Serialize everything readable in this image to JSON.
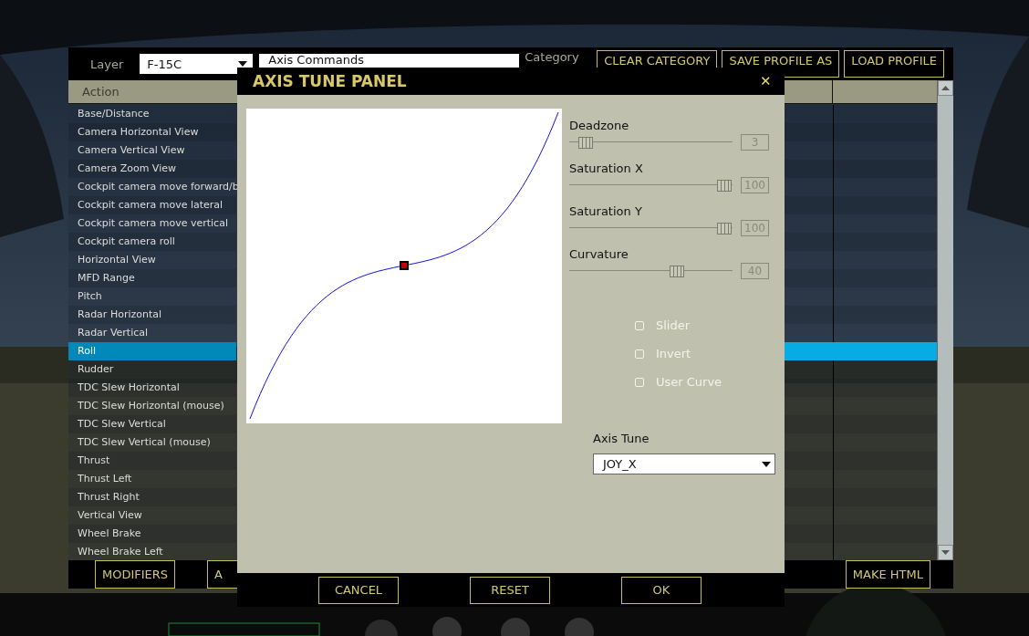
{
  "layer": {
    "label": "Layer",
    "value": "F-15C"
  },
  "category_field": {
    "value": "Axis Commands"
  },
  "category_label": "Category",
  "top_buttons": [
    "CLEAR CATEGORY",
    "SAVE PROFILE AS",
    "LOAD PROFILE"
  ],
  "table": {
    "columns": [
      "Action"
    ],
    "rows": [
      {
        "label": "Base/Distance",
        "selected": false
      },
      {
        "label": "Camera Horizontal View",
        "selected": false
      },
      {
        "label": "Camera Vertical View",
        "selected": false
      },
      {
        "label": "Camera Zoom View",
        "selected": false
      },
      {
        "label": "Cockpit camera move forward/b",
        "selected": false
      },
      {
        "label": "Cockpit camera move lateral",
        "selected": false
      },
      {
        "label": "Cockpit camera move vertical",
        "selected": false
      },
      {
        "label": "Cockpit camera roll",
        "selected": false
      },
      {
        "label": "Horizontal View",
        "selected": false
      },
      {
        "label": "MFD Range",
        "selected": false
      },
      {
        "label": "Pitch",
        "selected": false
      },
      {
        "label": "Radar Horizontal",
        "selected": false
      },
      {
        "label": "Radar Vertical",
        "selected": false
      },
      {
        "label": "Roll",
        "selected": true
      },
      {
        "label": "Rudder",
        "selected": false
      },
      {
        "label": "TDC Slew Horizontal",
        "selected": false
      },
      {
        "label": "TDC Slew Horizontal (mouse)",
        "selected": false
      },
      {
        "label": "TDC Slew Vertical",
        "selected": false
      },
      {
        "label": "TDC Slew Vertical (mouse)",
        "selected": false
      },
      {
        "label": "Thrust",
        "selected": false
      },
      {
        "label": "Thrust Left",
        "selected": false
      },
      {
        "label": "Thrust Right",
        "selected": false
      },
      {
        "label": "Vertical View",
        "selected": false
      },
      {
        "label": "Wheel Brake",
        "selected": false
      },
      {
        "label": "Wheel Brake Left",
        "selected": false
      }
    ]
  },
  "bottom_left_buttons": [
    "MODIFIERS",
    "A"
  ],
  "bottom_right_buttons": [
    "MAKE HTML"
  ],
  "dialog": {
    "title": "AXIS TUNE PANEL",
    "close": "✕",
    "sliders": [
      {
        "label": "Deadzone",
        "level": 0.06,
        "reading": "3"
      },
      {
        "label": "Saturation X",
        "level": 1,
        "reading": "100"
      },
      {
        "label": "Saturation Y",
        "level": 1,
        "reading": "100"
      },
      {
        "label": "Curvature",
        "level": 0.68,
        "reading": "40"
      }
    ],
    "options": [
      {
        "label": "Slider",
        "checked": false
      },
      {
        "label": "Invert",
        "checked": false
      },
      {
        "label": "User Curve",
        "checked": false
      }
    ],
    "axis_tune": {
      "label": "Axis Tune",
      "value": "JOY_X"
    },
    "buttons": [
      "CANCEL",
      "RESET",
      "OK"
    ]
  }
}
